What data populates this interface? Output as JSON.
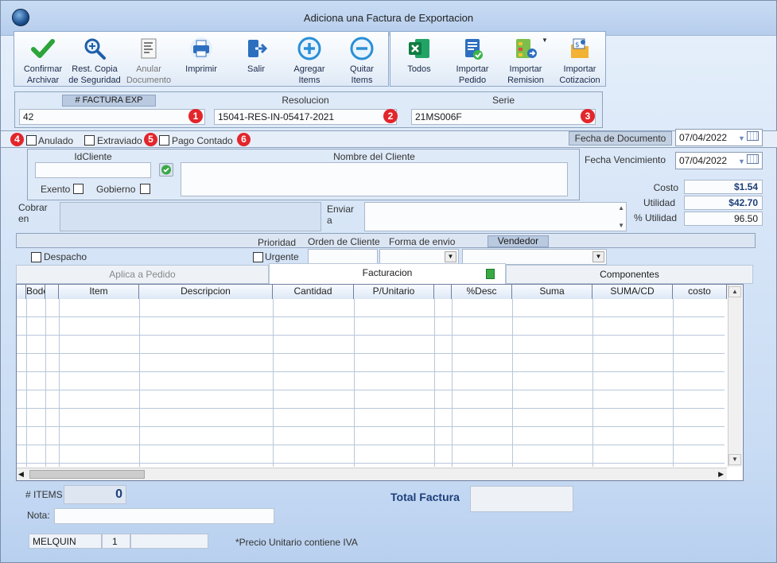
{
  "window": {
    "title": "Adiciona una Factura de Exportacion"
  },
  "toolbar": {
    "group1": [
      {
        "label": "Confirmar\nArchivar",
        "icon": "check-icon",
        "enabled": true
      },
      {
        "label": "Rest. Copia\nde Seguridad",
        "icon": "zoom-in-icon",
        "enabled": true
      },
      {
        "label": "Anular\nDocumento",
        "icon": "document-icon",
        "enabled": false
      },
      {
        "label": "Imprimir",
        "icon": "printer-icon",
        "enabled": true
      },
      {
        "label": "Salir",
        "icon": "exit-icon",
        "enabled": true
      },
      {
        "label": "Agregar\nItems",
        "icon": "plus-circle-icon",
        "enabled": true
      },
      {
        "label": "Quitar\nItems",
        "icon": "minus-circle-icon",
        "enabled": true
      }
    ],
    "group2": [
      {
        "label": "Todos",
        "icon": "excel-icon"
      },
      {
        "label": "Importar\nPedido",
        "icon": "order-import-icon"
      },
      {
        "label": "Importar\nRemision",
        "icon": "flow-import-icon"
      },
      {
        "label": "Importar\nCotizacion",
        "icon": "quote-import-icon"
      }
    ]
  },
  "header": {
    "factura_label": "# FACTURA EXP",
    "factura_value": "42",
    "resolucion_label": "Resolucion",
    "resolucion_value": "15041-RES-IN-05417-2021",
    "serie_label": "Serie",
    "serie_value": "21MS006F",
    "badges": [
      "1",
      "2",
      "3",
      "4",
      "5",
      "6"
    ]
  },
  "flags": {
    "anulado": "Anulado",
    "extraviado": "Extraviado",
    "pago_contado": "Pago Contado"
  },
  "fecha_documento": {
    "label": "Fecha de Documento",
    "value": "07/04/2022"
  },
  "fecha_vencimiento": {
    "label": "Fecha Vencimiento",
    "value": "07/04/2022"
  },
  "cliente": {
    "id_label": "IdCliente",
    "nombre_label": "Nombre del Cliente",
    "exento": "Exento",
    "gobierno": "Gobierno",
    "id_value": "",
    "nombre_value": ""
  },
  "cobrar_label": "Cobrar\nen",
  "enviar_label": "Enviar\na",
  "summary": {
    "costo_label": "Costo",
    "costo_value": "$1.54",
    "utilidad_label": "Utilidad",
    "utilidad_value": "$42.70",
    "putilidad_label": "% Utilidad",
    "putilidad_value": "96.50"
  },
  "envio": {
    "prioridad": "Prioridad",
    "orden_cliente": "Orden de Cliente",
    "forma_envio": "Forma de envio",
    "vendedor": "Vendedor",
    "despacho": "Despacho",
    "urgente": "Urgente"
  },
  "tabs": [
    "Aplica a Pedido",
    "Facturacion",
    "Componentes"
  ],
  "grid": {
    "columns": [
      "",
      "Bodega",
      "",
      "Item",
      "Descripcion",
      "Cantidad",
      "P/Unitario",
      "",
      "%Desc",
      "Suma",
      "SUMA/CD",
      "costo"
    ],
    "rows": []
  },
  "footer": {
    "items_label": "# ITEMS",
    "items_value": "0",
    "nota_label": "Nota:",
    "total_label": "Total Factura",
    "total_value": "",
    "user": "MELQUIN",
    "user_num": "1",
    "precio_note": "*Precio Unitario contiene IVA"
  },
  "colors": {
    "accent": "#1d3f7a",
    "badge": "#e2262b",
    "panel": "#dfeaf8"
  }
}
